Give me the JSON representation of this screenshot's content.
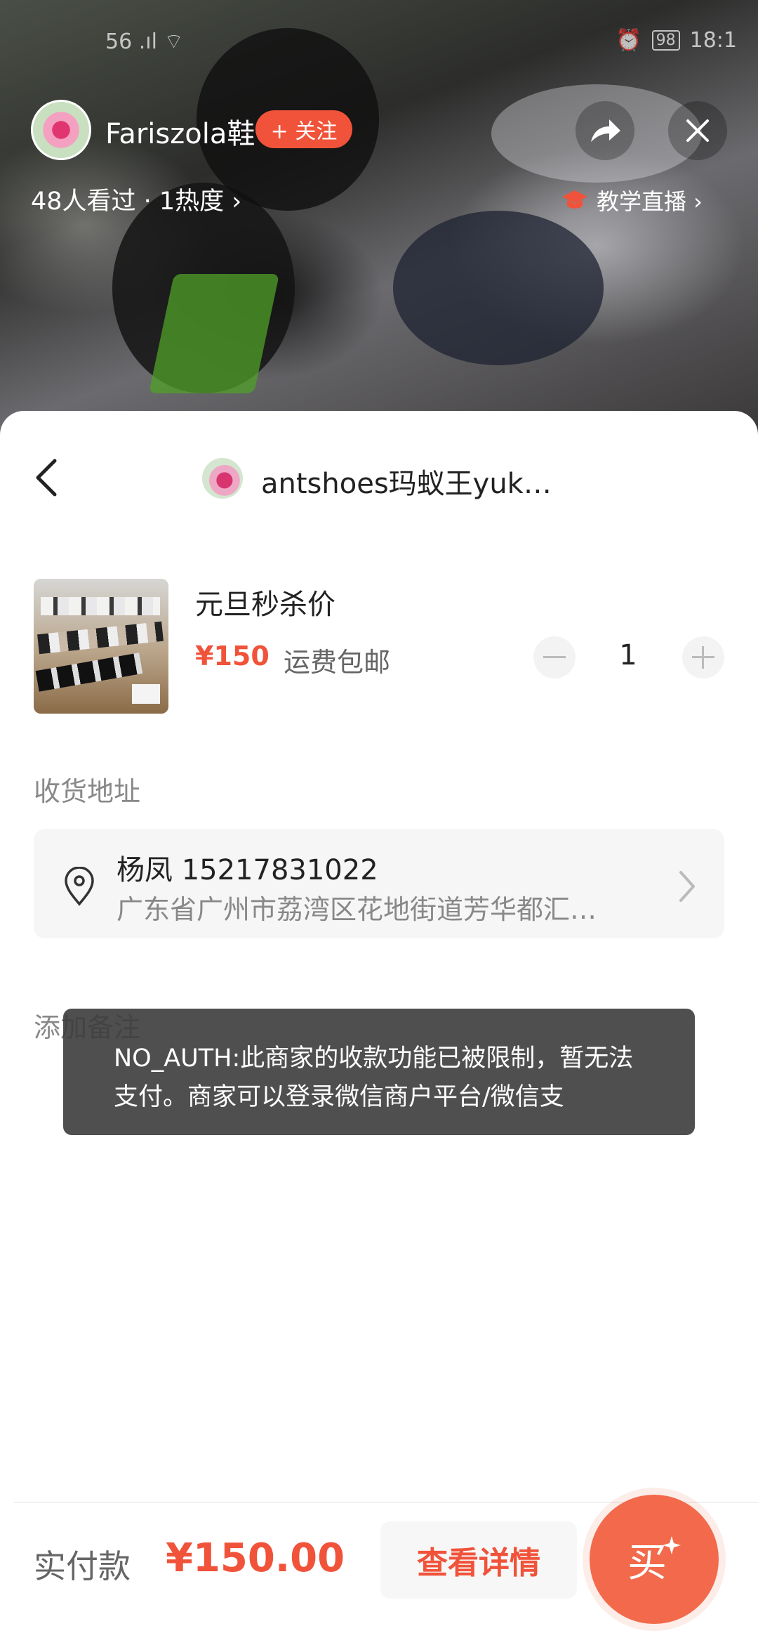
{
  "status_bar": {
    "left": "56 .ıl ⌔",
    "battery": "98",
    "time": "18:1"
  },
  "live": {
    "host_name": "Fariszola鞋",
    "follow_label": "+ 关注",
    "viewers": "48人看过 · 1热度 ›",
    "teach_label": "教学直播 ›"
  },
  "order": {
    "shop_name": "antshoes玛蚁王yuk…",
    "product_title": "元旦秒杀价",
    "price": "¥150",
    "shipping": "运费包邮",
    "quantity": "1",
    "address_label": "收货地址",
    "address_name": "杨凤  15217831022",
    "address_detail": "广东省广州市荔湾区花地街道芳华都汇…",
    "remark_label": "添加备注"
  },
  "toast": {
    "message": "NO_AUTH:此商家的收款功能已被限制，暂无法支付。商家可以登录微信商户平台/微信支"
  },
  "footer": {
    "pay_label": "实付款",
    "pay_total": "¥150.00",
    "detail_button": "查看详情",
    "buy_button": "买"
  },
  "colors": {
    "accent": "#f0533a",
    "buy": "#f26a4b"
  }
}
